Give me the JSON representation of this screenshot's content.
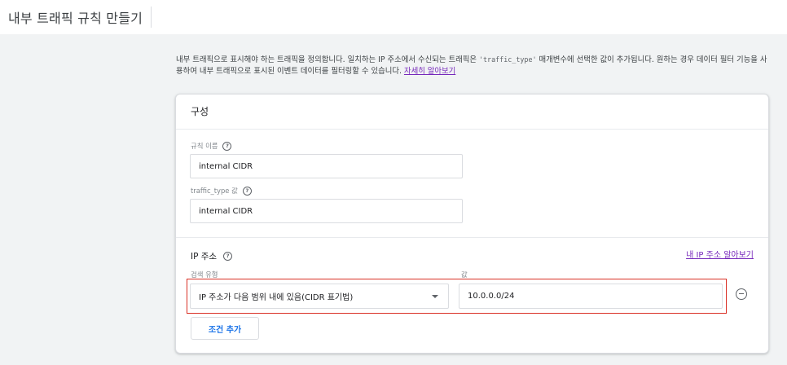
{
  "header": {
    "title": "내부 트래픽 규칙 만들기"
  },
  "intro": {
    "text_before": "내부 트래픽으로 표시해야 하는 트래픽을 정의합니다. 일치하는 IP 주소에서 수신되는 트래픽은 ",
    "code": "'traffic_type'",
    "text_after": " 매개변수에 선택한 값이 추가됩니다. 원하는 경우 데이터 필터 기능을 사용하여 내부 트래픽으로 표시된 이벤트 데이터를 필터링할 수 있습니다. ",
    "link": "자세히 알아보기"
  },
  "card": {
    "title": "구성",
    "rule_name": {
      "label": "규칙 이름",
      "value": "internal CIDR"
    },
    "traffic_type": {
      "label": "traffic_type 값",
      "value": "internal CIDR"
    },
    "ip_section": {
      "label": "IP 주소",
      "find_my_ip_link": "내 IP 주소 알아보기",
      "match_type_label": "검색 유형",
      "value_label": "값",
      "match_type_selected": "IP 주소가 다음 범위 내에 있음(CIDR 표기법)",
      "value": "10.0.0.0/24",
      "add_condition_label": "조건 추가"
    }
  },
  "icons": {
    "help": "help-circle-icon",
    "dropdown": "chevron-down-icon",
    "remove": "remove-circle-icon"
  },
  "colors": {
    "accent": "#1a73e8",
    "link": "#7627bb",
    "highlight": "#d93025"
  }
}
